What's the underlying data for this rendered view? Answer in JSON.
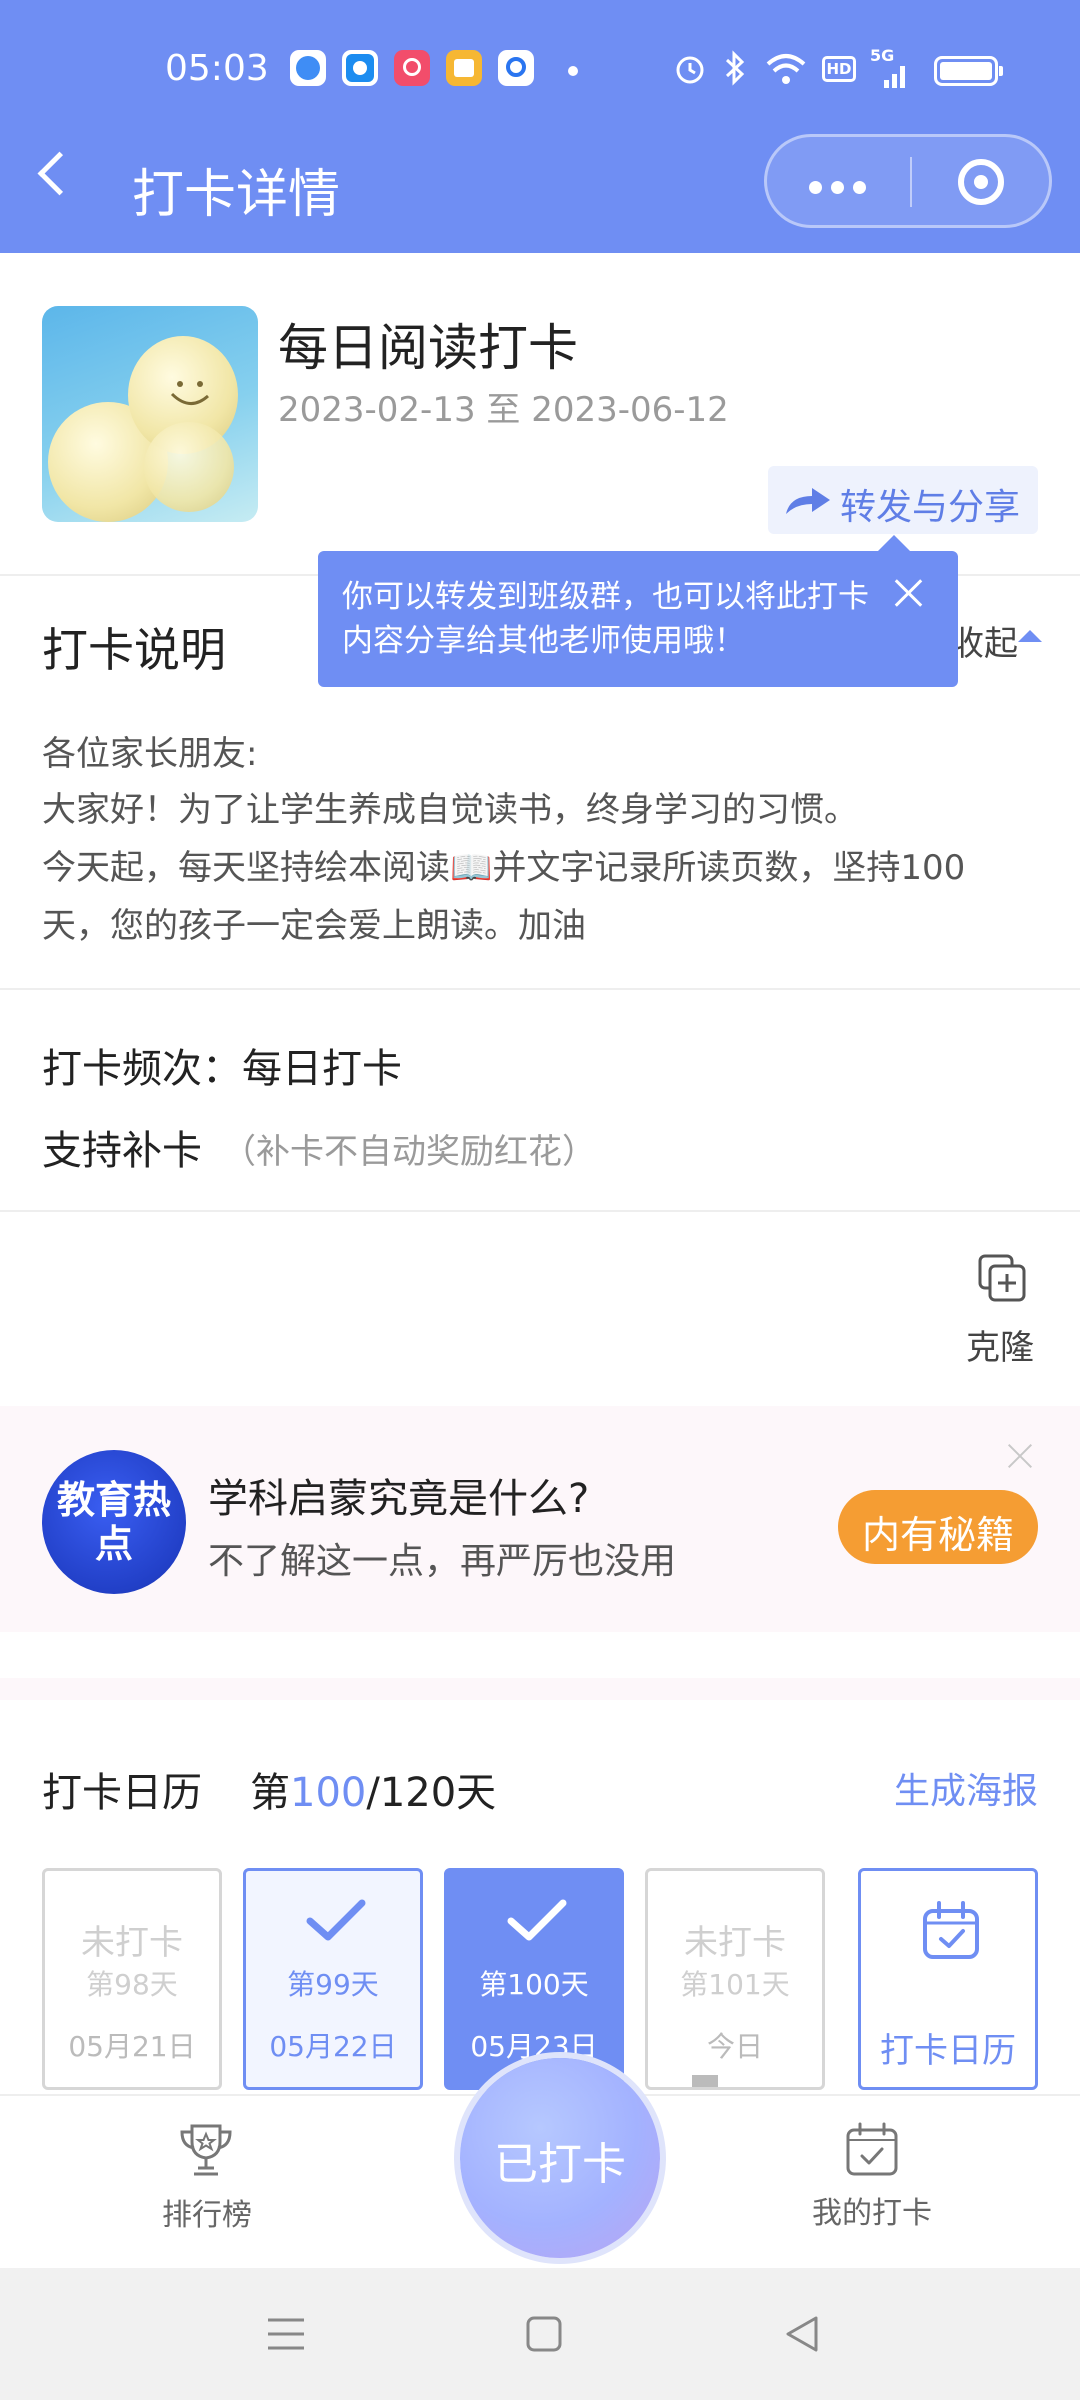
{
  "status_bar": {
    "time": "05:03",
    "indicators": [
      "alarm-icon",
      "bluetooth-icon",
      "wifi-icon",
      "HD",
      "5G",
      "battery-icon"
    ]
  },
  "nav": {
    "title": "打卡详情"
  },
  "activity": {
    "title": "每日阅读打卡",
    "date_range": "2023-02-13 至 2023-06-12",
    "share_label": "转发与分享"
  },
  "tooltip": {
    "text": "你可以转发到班级群，也可以将此打卡内容分享给其他老师使用哦！"
  },
  "description": {
    "title": "打卡说明",
    "collapse_label": "收起",
    "lines": [
      "各位家长朋友:",
      "大家好！为了让学生养成自觉读书，终身学习的习惯。",
      "今天起，每天坚持绘本阅读📖并文字记录所读页数，坚持100",
      "天，您的孩子一定会爱上朗读。加油"
    ]
  },
  "settings": {
    "frequency": "打卡频次：每日打卡",
    "makeup": "支持补卡",
    "makeup_note": "（补卡不自动奖励红花）"
  },
  "clone": {
    "label": "克隆"
  },
  "ad": {
    "badge": "教育热点",
    "title": "学科启蒙究竟是什么?",
    "subtitle": "不了解这一点，再严厉也没用",
    "button": "内有秘籍"
  },
  "calendar": {
    "title": "打卡日历",
    "count_prefix": "第",
    "current_day": "100",
    "count_suffix": "/120天",
    "poster_link": "生成海报",
    "days": [
      {
        "status": "未打卡",
        "label": "第98天",
        "date": "05月21日",
        "state": "missed"
      },
      {
        "status": "",
        "label": "第99天",
        "date": "05月22日",
        "state": "done"
      },
      {
        "status": "",
        "label": "第100天",
        "date": "05月23日",
        "state": "selected"
      },
      {
        "status": "未打卡",
        "label": "第101天",
        "date": "今日",
        "state": "today"
      }
    ],
    "calendar_button": "打卡日历"
  },
  "bottom_tabs": {
    "ranking": "排行榜",
    "punch": "已打卡",
    "my_punch": "我的打卡"
  },
  "colors": {
    "primary": "#6f8ef3",
    "accent_orange": "#f59d33",
    "muted_text": "#9a9a9a"
  }
}
